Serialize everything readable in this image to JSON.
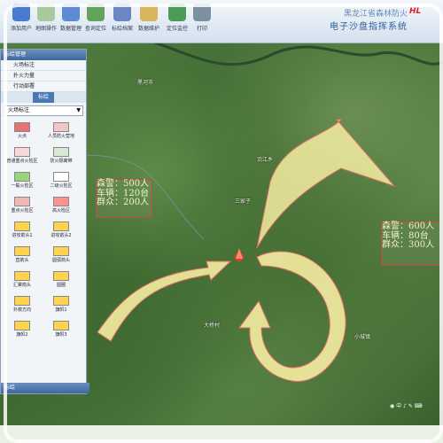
{
  "toolbar": {
    "items": [
      {
        "label": "添加用户",
        "icon": "user-add-icon"
      },
      {
        "label": "地图操作",
        "icon": "map-icon"
      },
      {
        "label": "数据管理",
        "icon": "database-icon"
      },
      {
        "label": "查询定位",
        "icon": "locate-icon"
      },
      {
        "label": "标绘档案",
        "icon": "archive-icon"
      },
      {
        "label": "数据维护",
        "icon": "maintenance-icon"
      },
      {
        "label": "定位监控",
        "icon": "monitor-icon"
      },
      {
        "label": "打印",
        "icon": "print-icon"
      }
    ]
  },
  "header": {
    "title_line1": "黑龙江省森林防火",
    "title_line2": "电子沙盘指挥系统",
    "logo_text": "HL"
  },
  "panel": {
    "title": "标绘管理",
    "tree": [
      "火场标注",
      "扑火力量",
      "行动部署"
    ],
    "tab": "标绘",
    "dropdown_value": "火场标注",
    "symbols": [
      {
        "label": "火点",
        "color": "#e57373"
      },
      {
        "label": "人员防火营地",
        "color": "#f3c6c6"
      },
      {
        "label": "普通重点火险区",
        "color": "#f8d8d8"
      },
      {
        "label": "防火隔离带",
        "color": "#d7e9d2"
      },
      {
        "label": "一般火险区",
        "color": "#9bd37a"
      },
      {
        "label": "二级火险区",
        "color": "#ffffff"
      },
      {
        "label": "重点火险区",
        "color": "#f2b6b6"
      },
      {
        "label": "高火险区",
        "color": "#ff9090"
      },
      {
        "label": "进攻箭头1",
        "color": "#ffd34d"
      },
      {
        "label": "进攻箭头2",
        "color": "#ffd34d"
      },
      {
        "label": "直箭头",
        "color": "#ffd34d"
      },
      {
        "label": "圆弧箭头",
        "color": "#ffd34d"
      },
      {
        "label": "汇聚箭头",
        "color": "#ffd34d"
      },
      {
        "label": "圆圈",
        "color": "#ffd34d"
      },
      {
        "label": "扑救方向",
        "color": "#ffd34d"
      },
      {
        "label": "旗帜1",
        "color": "#ffd34d"
      },
      {
        "label": "旗帜2",
        "color": "#ffd34d"
      },
      {
        "label": "旗帜3",
        "color": "#ffd34d"
      }
    ],
    "bottom_label": "标绘"
  },
  "callouts": [
    {
      "lines": [
        "森警：500人",
        "车辆：120台",
        "群众：200人"
      ]
    },
    {
      "lines": [
        "森警：600人",
        "车辆：80台",
        "群众：300人"
      ]
    }
  ],
  "places": [
    "黑河市",
    "火灾点",
    "三家子",
    "沿江乡",
    "小城镇",
    "大桥村"
  ],
  "statusbar": {
    "text": "◉ 中 ♪ ✎ ⌨"
  },
  "colors": {
    "arrow_fill": "#fff4a8",
    "arrow_stroke": "#ff6b6b",
    "fire": "#e53935"
  }
}
